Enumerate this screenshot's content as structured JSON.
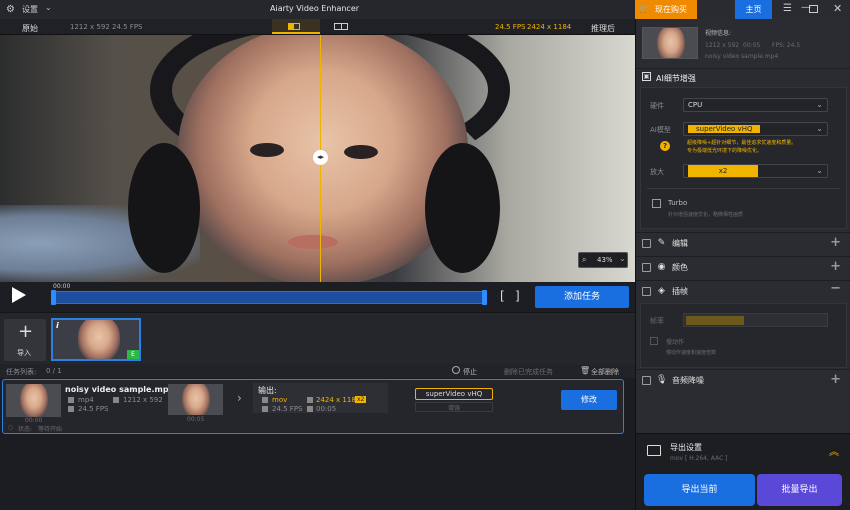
{
  "titlebar": {
    "settings_label": "设置",
    "app_title": "Aiarty Video Enhancer",
    "buy_label": "现在购买",
    "home_label": "主页"
  },
  "subbar": {
    "original_label": "原始",
    "original_info": "1212 x 592  24.5 FPS",
    "processed_info_fps": "24.5 FPS",
    "processed_info_res": "2424 x 1184",
    "processed_label": "推理后"
  },
  "video": {
    "zoom": "43%"
  },
  "controls": {
    "time": "00:00",
    "add_task_label": "添加任务"
  },
  "thumbs": {
    "import_label": "导入",
    "badge": "E"
  },
  "taskbar": {
    "list_label": "任务列表:",
    "list_count": "0 / 1",
    "stop_label": "停止",
    "remove_done_label": "删除已完成任务",
    "remove_all_label": "全部删除"
  },
  "task": {
    "name": "noisy video sample.mp4",
    "thumb_time": "00:00",
    "thumb2_time": "00:05",
    "src_format": "mp4",
    "src_res": "1212 x 592",
    "src_fps": "24.5 FPS",
    "output_label": "输出:",
    "out_format": "mov",
    "out_res": "2424 x 1184",
    "out_scale": "x2",
    "out_fps": "24.5 FPS",
    "out_dur": "00:05",
    "model_tag": "superVideo vHQ",
    "model_sub": "增强",
    "edit_label": "修改",
    "status_label": "状态:",
    "status_value": "等待开始"
  },
  "right": {
    "info_title": "视频信息:",
    "info_res": "1212 x 592",
    "info_dur": "00:05",
    "info_fps": "FPS: 24.5",
    "info_file": "noisy video sample.mp4",
    "ai_section": "AI细节增强",
    "hardware_label": "硬件",
    "hardware_value": "CPU",
    "model_label": "AI模型",
    "model_value": "superVideo vHQ",
    "model_desc_1": "超级降噪+超针对细节，最佳追求优速度和质量。",
    "model_desc_2": "专为极端低光环境下的降噪优化。",
    "scale_label": "放大",
    "scale_value": "x2",
    "turbo_label": "Turbo",
    "turbo_desc": "针对增强速度优化，略微牺牲画质",
    "edit_section": "编辑",
    "color_section": "颜色",
    "interp_section": "插帧",
    "interp_rate_label": "帧率",
    "interp_slow_label": "慢动作",
    "interp_slow_desc": "慢动作速度和速度倍数",
    "audio_section": "音频降噪",
    "export_title": "导出设置",
    "export_info": "mov [ H.264, AAC ]",
    "export_current": "导出当前",
    "export_batch": "批量导出"
  },
  "colors": {
    "accent": "#1a6fe0",
    "warn": "#f0b400",
    "orange": "#f08a00",
    "purple": "#6a4ee0"
  }
}
